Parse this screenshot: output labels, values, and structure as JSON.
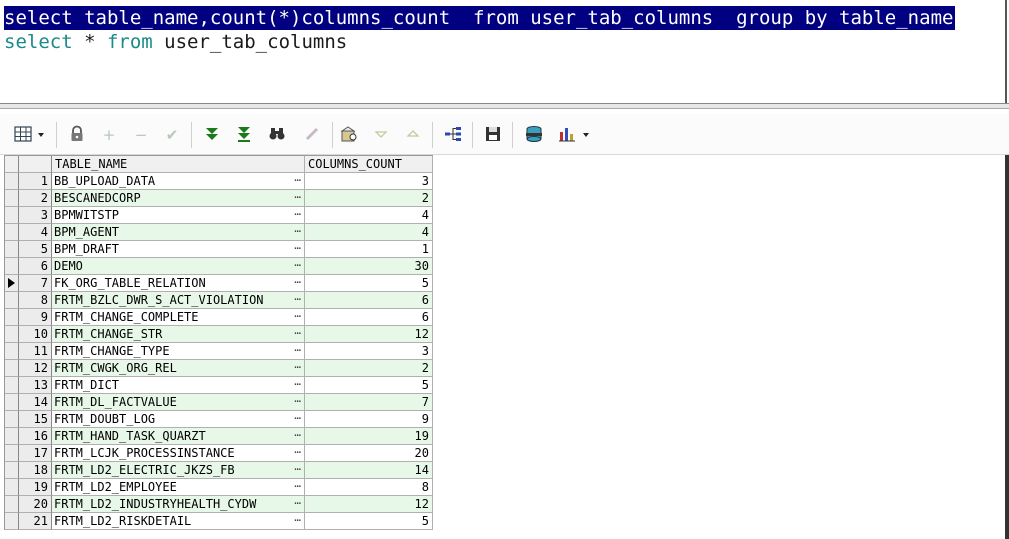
{
  "editor": {
    "line1": {
      "kw_select": "select",
      "body": " table_name,count(*)columns_count  from user_tab_columns  group by table_name"
    },
    "line2": {
      "kw_select": "select",
      "star": " * ",
      "kw_from": "from",
      "table": " user_tab_columns"
    }
  },
  "toolbar": {
    "icons": [
      "grid-icon",
      "dropdown-arrow-icon",
      "lock-icon",
      "plus-icon",
      "minus-icon",
      "check-icon",
      "next-page-icon",
      "last-page-icon",
      "binoculars-icon",
      "clear-icon",
      "query-icon",
      "down-icon",
      "up-icon",
      "tree-icon",
      "save-icon",
      "database-icon",
      "chart-icon"
    ]
  },
  "grid": {
    "columns": [
      "TABLE_NAME",
      "COLUMNS_COUNT"
    ],
    "current_row": 7,
    "rows": [
      {
        "num": "1",
        "name": "BB_UPLOAD_DATA",
        "count": "3"
      },
      {
        "num": "2",
        "name": "BESCANEDCORP",
        "count": "2"
      },
      {
        "num": "3",
        "name": "BPMWITSTP",
        "count": "4"
      },
      {
        "num": "4",
        "name": "BPM_AGENT",
        "count": "4"
      },
      {
        "num": "5",
        "name": "BPM_DRAFT",
        "count": "1"
      },
      {
        "num": "6",
        "name": "DEMO",
        "count": "30"
      },
      {
        "num": "7",
        "name": "FK_ORG_TABLE_RELATION",
        "count": "5"
      },
      {
        "num": "8",
        "name": "FRTM_BZLC_DWR_S_ACT_VIOLATION",
        "count": "6"
      },
      {
        "num": "9",
        "name": "FRTM_CHANGE_COMPLETE",
        "count": "6"
      },
      {
        "num": "10",
        "name": "FRTM_CHANGE_STR",
        "count": "12"
      },
      {
        "num": "11",
        "name": "FRTM_CHANGE_TYPE",
        "count": "3"
      },
      {
        "num": "12",
        "name": "FRTM_CWGK_ORG_REL",
        "count": "2"
      },
      {
        "num": "13",
        "name": "FRTM_DICT",
        "count": "5"
      },
      {
        "num": "14",
        "name": "FRTM_DL_FACTVALUE",
        "count": "7"
      },
      {
        "num": "15",
        "name": "FRTM_DOUBT_LOG",
        "count": "9"
      },
      {
        "num": "16",
        "name": "FRTM_HAND_TASK_QUARZT",
        "count": "19"
      },
      {
        "num": "17",
        "name": "FRTM_LCJK_PROCESSINSTANCE",
        "count": "20"
      },
      {
        "num": "18",
        "name": "FRTM_LD2_ELECTRIC_JKZS_FB",
        "count": "14"
      },
      {
        "num": "19",
        "name": "FRTM_LD2_EMPLOYEE",
        "count": "8"
      },
      {
        "num": "20",
        "name": "FRTM_LD2_INDUSTRYHEALTH_CYDW",
        "count": "12"
      },
      {
        "num": "21",
        "name": "FRTM_LD2_RISKDETAIL",
        "count": "5"
      }
    ]
  }
}
